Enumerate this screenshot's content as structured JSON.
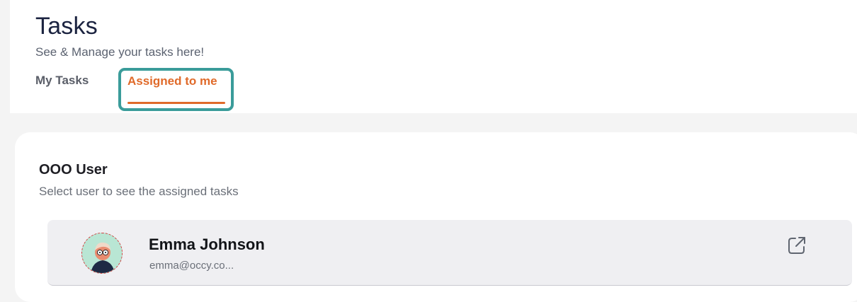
{
  "header": {
    "title": "Tasks",
    "subtitle": "See & Manage your tasks here!",
    "tabs": [
      {
        "label": "My Tasks",
        "active": false
      },
      {
        "label": "Assigned to me",
        "active": true
      }
    ]
  },
  "panel": {
    "title": "OOO User",
    "subtitle": "Select user to see the assigned tasks",
    "users": [
      {
        "name": "Emma Johnson",
        "email": "emma@occy.co...",
        "action_icon": "open-external-icon"
      }
    ]
  },
  "colors": {
    "accent": "#e06a2a",
    "highlight_border": "#3a9c9a",
    "title": "#1b2340"
  }
}
